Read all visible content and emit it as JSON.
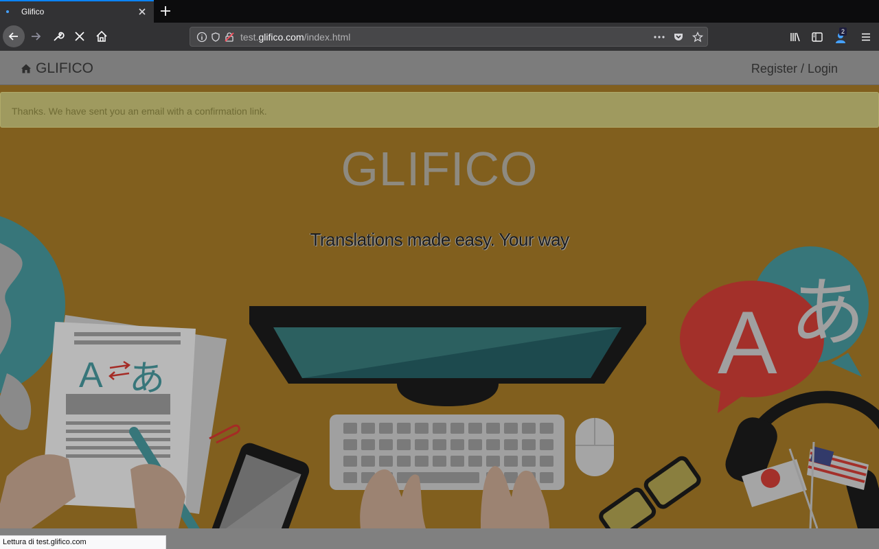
{
  "browser": {
    "tab_title": "Glifico",
    "url_prefix": "test.",
    "url_domain": "glifico.com",
    "url_path": "/index.html",
    "notification_count": "2",
    "status_text": "Lettura di test.glifico.com"
  },
  "nav": {
    "brand": "GLIFICO",
    "register_login": "Register / Login"
  },
  "alert": {
    "message": "Thanks. We have sent you an email with a confirmation link."
  },
  "hero": {
    "title": "GLIFICO",
    "subtitle": "Translations made easy. Your way"
  },
  "illustration": {
    "letter_a": "A",
    "letter_hiragana": "あ"
  },
  "colors": {
    "accent": "#0a84ff",
    "hero_background": "#815f1e",
    "alert_background": "#9f9a5f"
  }
}
